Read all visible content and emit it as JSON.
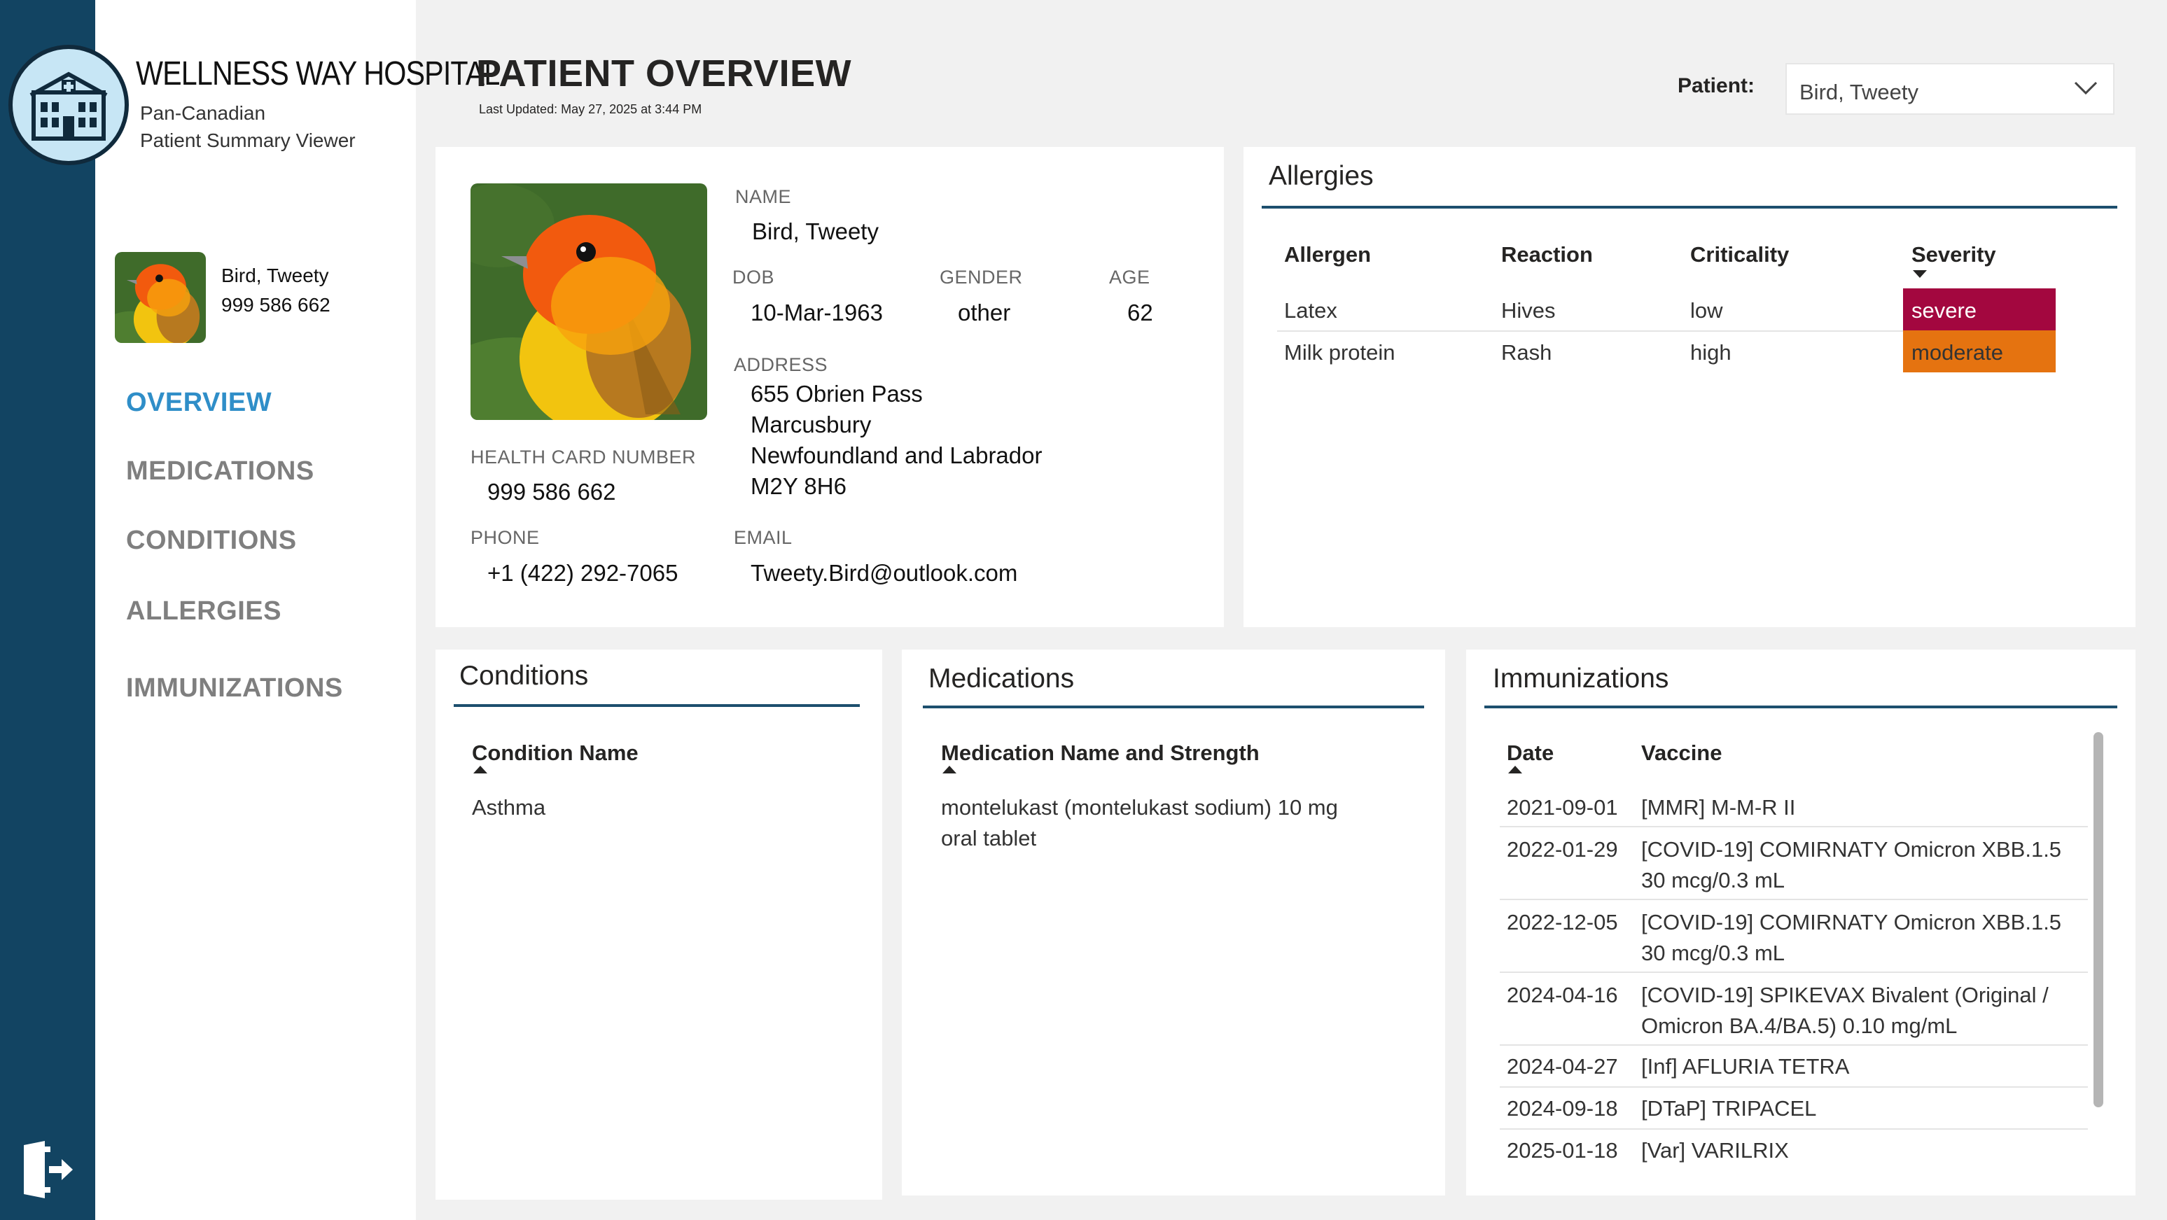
{
  "app": {
    "hospital_name": "WELLNESS WAY HOSPITAL",
    "subtitle_line1": "Pan-Canadian",
    "subtitle_line2": "Patient Summary Viewer",
    "logo_icon": "hospital-building-icon",
    "exit_icon": "exit-door-icon"
  },
  "sidebar": {
    "patient_name": "Bird, Tweety",
    "health_card": "999 586 662",
    "nav": [
      {
        "label": "OVERVIEW",
        "active": true
      },
      {
        "label": "MEDICATIONS",
        "active": false
      },
      {
        "label": "CONDITIONS",
        "active": false
      },
      {
        "label": "ALLERGIES",
        "active": false
      },
      {
        "label": "IMMUNIZATIONS",
        "active": false
      }
    ]
  },
  "header": {
    "title": "PATIENT OVERVIEW",
    "last_updated": "Last Updated: May 27, 2025 at 3:44 PM",
    "patient_label": "Patient:",
    "patient_selected": "Bird, Tweety"
  },
  "demographics": {
    "name_label": "NAME",
    "name": "Bird, Tweety",
    "dob_label": "DOB",
    "dob": "10-Mar-1963",
    "gender_label": "GENDER",
    "gender": "other",
    "age_label": "AGE",
    "age": "62",
    "address_label": "ADDRESS",
    "address": [
      "655 Obrien Pass",
      "Marcusbury",
      "Newfoundland and Labrador",
      "M2Y 8H6"
    ],
    "hcn_label": "HEALTH CARD NUMBER",
    "hcn": "999 586 662",
    "phone_label": "PHONE",
    "phone": "+1 (422) 292-7065",
    "email_label": "EMAIL",
    "email": "Tweety.Bird@outlook.com"
  },
  "allergies": {
    "title": "Allergies",
    "headers": [
      "Allergen",
      "Reaction",
      "Criticality",
      "Severity"
    ],
    "rows": [
      {
        "allergen": "Latex",
        "reaction": "Hives",
        "criticality": "low",
        "severity": "severe"
      },
      {
        "allergen": "Milk protein",
        "reaction": "Rash",
        "criticality": "high",
        "severity": "moderate"
      }
    ]
  },
  "conditions": {
    "title": "Conditions",
    "header": "Condition Name",
    "rows": [
      "Asthma"
    ]
  },
  "medications": {
    "title": "Medications",
    "header": "Medication Name and Strength",
    "rows": [
      [
        "montelukast (montelukast sodium) 10 mg",
        "oral tablet"
      ]
    ]
  },
  "immunizations": {
    "title": "Immunizations",
    "headers": [
      "Date",
      "Vaccine"
    ],
    "rows": [
      {
        "date": "2021-09-01",
        "vaccine": [
          "[MMR] M-M-R II"
        ]
      },
      {
        "date": "2022-01-29",
        "vaccine": [
          "[COVID-19] COMIRNATY Omicron XBB.1.5",
          "30 mcg/0.3 mL"
        ]
      },
      {
        "date": "2022-12-05",
        "vaccine": [
          "[COVID-19] COMIRNATY Omicron XBB.1.5",
          "30 mcg/0.3 mL"
        ]
      },
      {
        "date": "2024-04-16",
        "vaccine": [
          "[COVID-19] SPIKEVAX Bivalent (Original /",
          "Omicron BA.4/BA.5) 0.10 mg/mL"
        ]
      },
      {
        "date": "2024-04-27",
        "vaccine": [
          "[Inf] AFLURIA TETRA"
        ]
      },
      {
        "date": "2024-09-18",
        "vaccine": [
          "[DTaP] TRIPACEL"
        ]
      },
      {
        "date": "2025-01-18",
        "vaccine": [
          "[Var] VARILRIX"
        ]
      }
    ]
  },
  "colors": {
    "rail": "#124462",
    "nav_active": "#2f8ec8",
    "severe": "#a3073f",
    "moderate": "#e57310",
    "section_rule": "#1d4f6e"
  }
}
